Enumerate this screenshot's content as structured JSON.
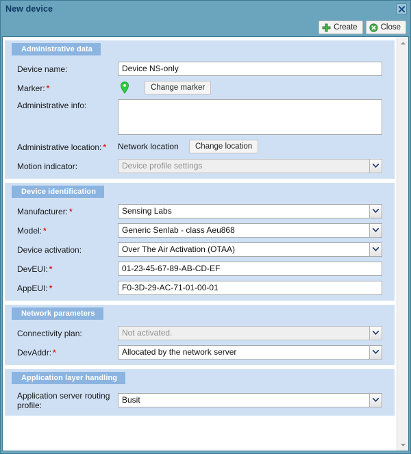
{
  "dialog": {
    "title": "New device",
    "close_icon": "close-x-icon"
  },
  "toolbar": {
    "create_label": "Create",
    "create_icon": "plus-icon",
    "close_label": "Close",
    "close_icon": "cancel-circle-icon"
  },
  "colors": {
    "titlebar": "#6ba5bd",
    "panel": "#cfe0f5",
    "section_header": "#8cb4e0",
    "required_asterisk": "#d42a1e",
    "accent_green": "#3faf46",
    "title_text": "#123a63"
  },
  "sections": [
    {
      "title": "Administrative data",
      "rows": [
        {
          "label": "Device name:",
          "required": false,
          "type": "text",
          "value": "Device NS-only"
        },
        {
          "label": "Marker:",
          "required": true,
          "type": "marker",
          "icon": "map-pin-icon",
          "button": "Change marker"
        },
        {
          "label": "Administrative info:",
          "required": false,
          "type": "textarea",
          "value": ""
        },
        {
          "label": "Administrative location:",
          "required": true,
          "type": "static-button",
          "value": "Network location",
          "button": "Change location"
        },
        {
          "label": "Motion indicator:",
          "required": false,
          "type": "select",
          "value": "Device profile settings",
          "disabled": true
        }
      ]
    },
    {
      "title": "Device identification",
      "rows": [
        {
          "label": "Manufacturer:",
          "required": true,
          "type": "select",
          "value": "Sensing Labs",
          "disabled": false
        },
        {
          "label": "Model:",
          "required": true,
          "type": "select",
          "value": "Generic Senlab - class A",
          "suffix": "eu868",
          "disabled": false
        },
        {
          "label": "Device activation:",
          "required": false,
          "type": "select",
          "value": "Over The Air Activation (OTAA)",
          "disabled": false
        },
        {
          "label": "DevEUI:",
          "required": true,
          "type": "text",
          "value": "01-23-45-67-89-AB-CD-EF"
        },
        {
          "label": "AppEUI:",
          "required": true,
          "type": "text",
          "value": "F0-3D-29-AC-71-01-00-01"
        }
      ]
    },
    {
      "title": "Network parameters",
      "rows": [
        {
          "label": "Connectivity plan:",
          "required": false,
          "type": "select",
          "value": "Not activated.",
          "disabled": true
        },
        {
          "label": "DevAddr:",
          "required": true,
          "type": "select",
          "value": "Allocated by the network server",
          "disabled": false
        }
      ]
    },
    {
      "title": "Application layer handling",
      "rows": [
        {
          "label": "Application server routing profile:",
          "required": false,
          "type": "select",
          "value": "Busit",
          "disabled": false
        }
      ]
    }
  ],
  "scrollbar": {
    "up_icon": "scroll-up-arrow-icon",
    "down_icon": "scroll-down-arrow-icon"
  }
}
